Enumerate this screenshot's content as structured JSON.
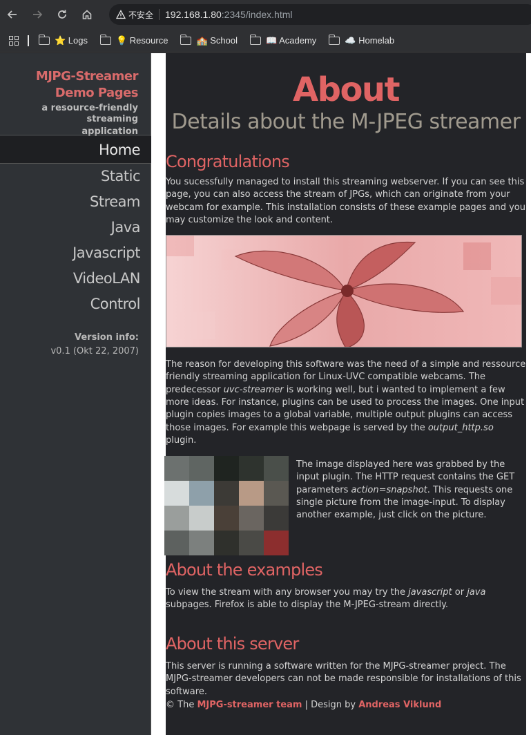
{
  "browser": {
    "security_label": "不安全",
    "url_host": "192.168.1.80",
    "url_rest": ":2345/index.html",
    "bookmarks": [
      {
        "label": "⭐ Logs"
      },
      {
        "label": "💡 Resource"
      },
      {
        "label": "🏫 School"
      },
      {
        "label": "📖 Academy"
      },
      {
        "label": "☁️ Homelab"
      }
    ]
  },
  "sidebar": {
    "brand_line1": "MJPG-Streamer",
    "brand_line2": "Demo Pages",
    "tagline_line1": "a resource-friendly streaming",
    "tagline_line2": "application",
    "menu": [
      "Home",
      "Static",
      "Stream",
      "Java",
      "Javascript",
      "VideoLAN",
      "Control"
    ],
    "version_label": "Version info:",
    "version_value": "v0.1 (Okt 22, 2007)"
  },
  "main": {
    "title": "About",
    "subtitle": "Details about the M-JPEG streamer",
    "congrats_heading": "Congratulations",
    "congrats_text": "You sucessfully managed to install this streaming webserver. If you can see this page, you can also access the stream of JPGs, which can originate from your webcam for example. This installation consists of these example pages and you may customize the look and content.",
    "reason_text_1": "The reason for developing this software was the need of a simple and ressource friendly streaming application for Linux-UVC compatible webcams. The predecessor ",
    "reason_text_em1": "uvc-streamer",
    "reason_text_2": " is working well, but i wanted to implement a few more ideas. For instance, plugins can be used to process the images. One input plugin copies images to a global variable, multiple output plugins can access those images. For example this webpage is served by the ",
    "reason_text_em2": "output_http.so",
    "reason_text_3": " plugin.",
    "snapshot_text_1": "The image displayed here was grabbed by the input plugin. The HTTP request contains the GET parameters ",
    "snapshot_text_em": "action=snapshot",
    "snapshot_text_2": ". This requests one single picture from the image-input. To display another example, just click on the picture.",
    "examples_heading": "About the examples",
    "examples_text_1": "To view the stream with any browser you may try the ",
    "examples_text_em1": "javascript",
    "examples_text_2": " or ",
    "examples_text_em2": "java",
    "examples_text_3": " subpages. Firefox is able to display the M-JPEG-stream directly.",
    "server_heading": "About this server",
    "server_text": "This server is running a software written for the MJPG-streamer project. The MJPG-streamer developers can not be made responsible for installations of this software.",
    "footer_prefix": "© The ",
    "footer_link1": "MJPG-streamer team",
    "footer_mid": " | Design by ",
    "footer_link2": "Andreas Viklund"
  }
}
